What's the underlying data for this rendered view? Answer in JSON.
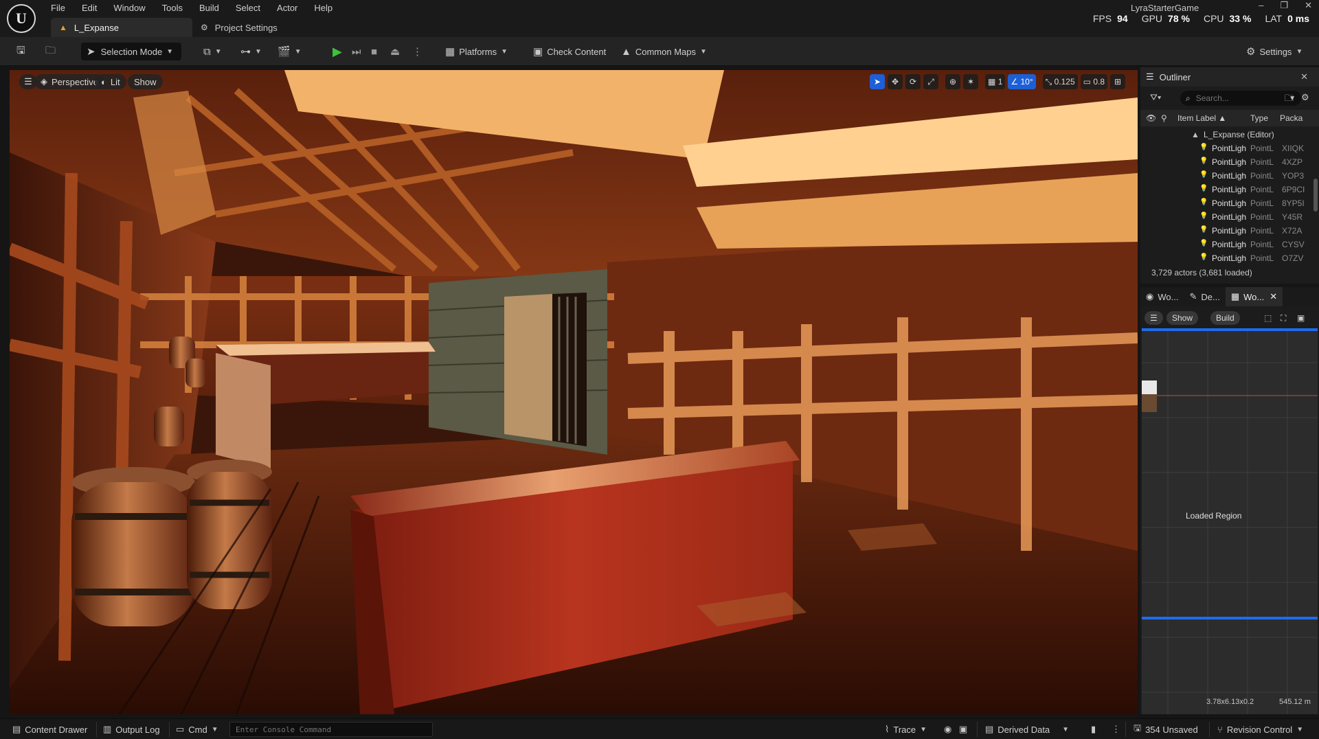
{
  "app": {
    "project_name": "LyraStarterGame",
    "logo": "unreal-engine-logo"
  },
  "menu": [
    "File",
    "Edit",
    "Window",
    "Tools",
    "Build",
    "Select",
    "Actor",
    "Help"
  ],
  "tabs": {
    "level": "L_Expanse",
    "project_settings": "Project Settings"
  },
  "window_controls": [
    "–",
    "❐",
    "✕"
  ],
  "stats": {
    "fps_label": "FPS",
    "fps_value": "94",
    "gpu_label": "GPU",
    "gpu_value": "78 %",
    "cpu_label": "CPU",
    "cpu_value": "33 %",
    "lat_label": "LAT",
    "lat_value": "0 ms"
  },
  "toolbar": {
    "selection_mode": "Selection Mode",
    "platforms": "Platforms",
    "check_content": "Check Content",
    "common_maps": "Common Maps",
    "settings": "Settings"
  },
  "viewport": {
    "perspective": "Perspective",
    "lit": "Lit",
    "show": "Show",
    "grid_snap": "1",
    "rotation_snap": "10°",
    "scale_snap": "0.125",
    "camera_speed": "0.8"
  },
  "outliner": {
    "title": "Outliner",
    "search_placeholder": "Search...",
    "columns": {
      "label": "Item Label ▲",
      "type": "Type",
      "package": "Packa"
    },
    "root": "L_Expanse (Editor)",
    "rows": [
      {
        "label": "PointLigh",
        "type": "PointL",
        "package": "XIIQK"
      },
      {
        "label": "PointLigh",
        "type": "PointL",
        "package": "4XZP"
      },
      {
        "label": "PointLigh",
        "type": "PointL",
        "package": "YOP3"
      },
      {
        "label": "PointLigh",
        "type": "PointL",
        "package": "6P9CI"
      },
      {
        "label": "PointLigh",
        "type": "PointL",
        "package": "8YP5I"
      },
      {
        "label": "PointLigh",
        "type": "PointL",
        "package": "Y45R"
      },
      {
        "label": "PointLigh",
        "type": "PointL",
        "package": "X72A"
      },
      {
        "label": "PointLigh",
        "type": "PointL",
        "package": "CYSV"
      },
      {
        "label": "PointLigh",
        "type": "PointL",
        "package": "O7ZV"
      }
    ],
    "status": "3,729 actors (3,681 loaded)"
  },
  "world_partition": {
    "tabs": [
      "Wo...",
      "De...",
      "Wo..."
    ],
    "show": "Show",
    "build": "Build",
    "loaded_region": "Loaded Region",
    "dimensions": "3.78x6.13x0.2",
    "distance": "545.12 m"
  },
  "statusbar": {
    "content_drawer": "Content Drawer",
    "output_log": "Output Log",
    "cmd": "Cmd",
    "console_placeholder": "Enter Console Command",
    "trace": "Trace",
    "derived_data": "Derived Data",
    "unsaved": "354 Unsaved",
    "revision_control": "Revision Control"
  },
  "colors": {
    "accent_blue": "#1d5fd6",
    "play_green": "#3fbf3f",
    "panel_bg": "#1c1c1c"
  }
}
